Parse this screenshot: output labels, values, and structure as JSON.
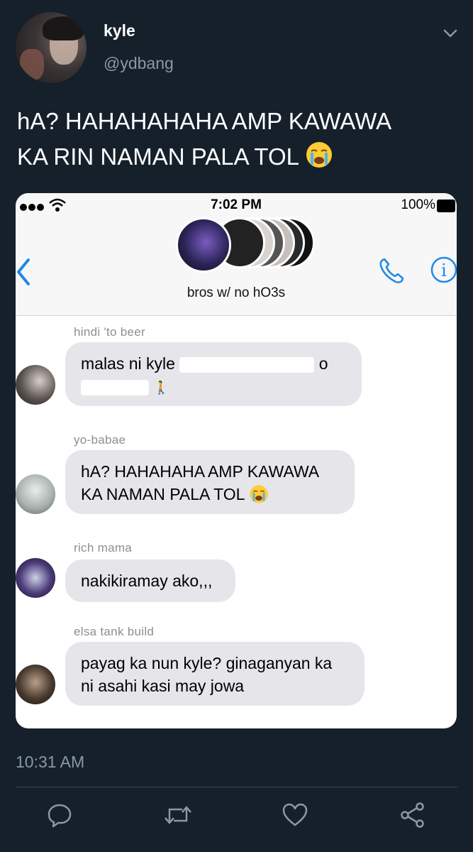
{
  "tweet": {
    "display_name": "kyle",
    "handle": "@ydbang",
    "text_line1": "hA? HAHAHAHAHA AMP KAWAWA",
    "text_line2": "KA RIN NAMAN PALA TOL",
    "text_emoji": "crying-face-emoji",
    "timestamp": "10:31 AM"
  },
  "screenshot": {
    "status_bar": {
      "time": "7:02 PM",
      "battery": "100%"
    },
    "group_name": "bros w/ no hO3s",
    "messages": [
      {
        "sender": "hindi 'to beer",
        "line1": "malas ni kyle",
        "line1_tail": "o",
        "line2_tail": ""
      },
      {
        "sender": "yo-babae",
        "line1": "hA? HAHAHAHA AMP KAWAWA",
        "line2": "KA NAMAN PALA TOL",
        "emoji": "crying-face-emoji"
      },
      {
        "sender": "rich mama",
        "line1": "nakikiramay ako,,,"
      },
      {
        "sender": "elsa tank build",
        "line1": "payag ka nun kyle? ginaganyan ka",
        "line2": "ni asahi kasi may jowa"
      }
    ]
  },
  "icons": {
    "menu": "chevron-down-icon",
    "reply": "reply-icon",
    "retweet": "retweet-icon",
    "like": "heart-icon",
    "share": "share-icon"
  },
  "colors": {
    "background": "#15202b",
    "secondary_text": "#8899a6",
    "ios_blue": "#1e88e5",
    "bubble": "#e5e5ea"
  }
}
